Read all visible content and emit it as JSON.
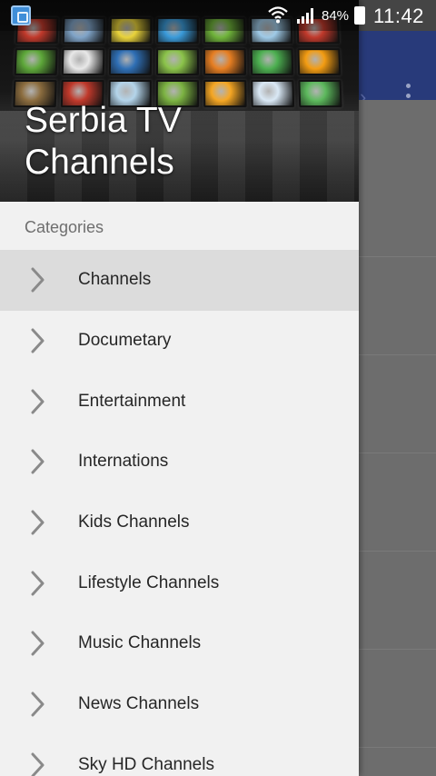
{
  "status_bar": {
    "battery_percent": "84%",
    "time": "11:42",
    "icons": [
      "app-notification-icon",
      "wifi-icon",
      "signal-icon",
      "battery-icon"
    ]
  },
  "drawer": {
    "header_title": "Serbia TV Channels",
    "section_label": "Categories",
    "items": [
      {
        "label": "Channels",
        "active": true
      },
      {
        "label": "Documetary"
      },
      {
        "label": "Entertainment"
      },
      {
        "label": "Internations"
      },
      {
        "label": "Kids Channels"
      },
      {
        "label": "Lifestyle Channels"
      },
      {
        "label": "Music Channels"
      },
      {
        "label": "News Channels"
      },
      {
        "label": "Sky HD Channels"
      }
    ]
  },
  "colors": {
    "appbar": "#283a7a",
    "drawer_bg": "#f1f1f1",
    "active_item": "#dcdcdc",
    "scrim": "#6b6b6b"
  }
}
